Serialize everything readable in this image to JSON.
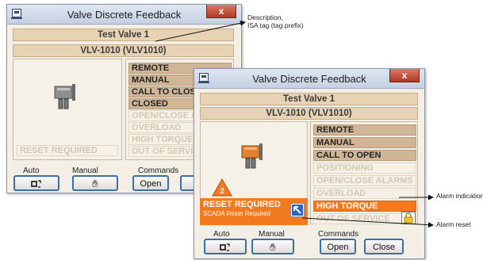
{
  "back_window": {
    "title": "Valve Discrete Feedback",
    "close_glyph": "x",
    "description": "Test Valve 1",
    "tag": "VLV-1010 (VLV1010)",
    "status_items": [
      {
        "label": "REMOTE",
        "state": "on"
      },
      {
        "label": "MANUAL",
        "state": "on"
      },
      {
        "label": "CALL TO CLOSE",
        "state": "on"
      },
      {
        "label": "CLOSED",
        "state": "on"
      },
      {
        "label": "OPEN/CLOSE ALARMS",
        "state": "off"
      },
      {
        "label": "OVERLOAD",
        "state": "off"
      },
      {
        "label": "HIGH TORQUE",
        "state": "off"
      },
      {
        "label": "OUT OF SERVICE",
        "state": "off"
      }
    ],
    "reset_label": "RESET REQUIRED",
    "auto_label": "Auto",
    "manual_label": "Manual",
    "commands_label": "Commands",
    "open_label": "Open"
  },
  "front_window": {
    "title": "Valve Discrete Feedback",
    "close_glyph": "x",
    "description": "Test Valve 1",
    "tag": "VLV-1010 (VLV1010)",
    "status_items": [
      {
        "label": "REMOTE",
        "state": "on"
      },
      {
        "label": "MANUAL",
        "state": "on"
      },
      {
        "label": "CALL TO OPEN",
        "state": "on"
      },
      {
        "label": "POSITIONING",
        "state": "off"
      },
      {
        "label": "OPEN/CLOSE ALARMS",
        "state": "off"
      },
      {
        "label": "OVERLOAD",
        "state": "off"
      },
      {
        "label": "HIGH TORQUE",
        "state": "alarm"
      },
      {
        "label": "OUT OF SERVICE",
        "state": "off"
      }
    ],
    "alarm_priority": "2",
    "reset_label": "RESET REQUIRED",
    "reset_sub": "SCADA Reset Required",
    "auto_label": "Auto",
    "manual_label": "Manual",
    "commands_label": "Commands",
    "open_label": "Open",
    "close_label": "Close"
  },
  "annotations": {
    "desc_line1": "Description,",
    "desc_line2": "ISA tag (tag prefix)",
    "alarm_indication": "Alarm indication",
    "alarm_reset": "Alarm reset"
  },
  "colors": {
    "status_on": "#d1b597",
    "status_off_text": "#d3c7b4",
    "alarm": "#f47a20",
    "titlebar": "#c4d0e2",
    "close_button": "#c0432b"
  }
}
